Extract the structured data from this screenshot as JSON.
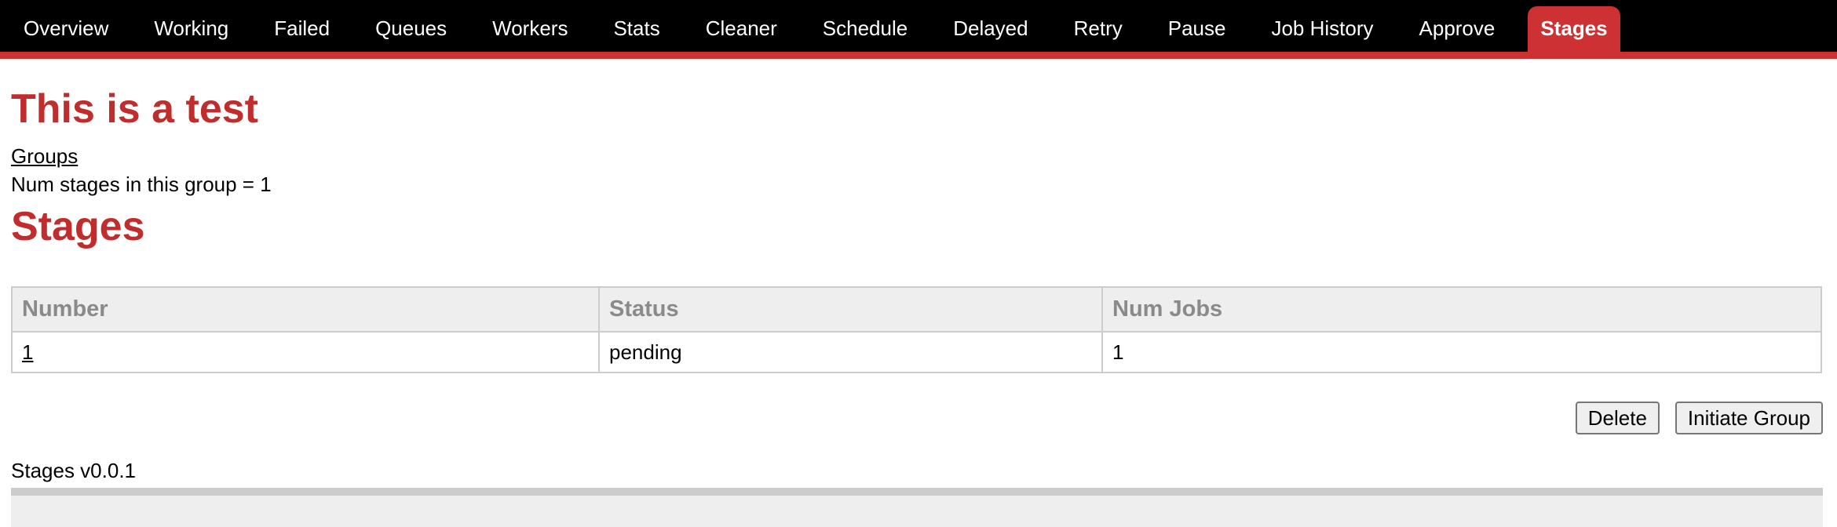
{
  "nav": {
    "tabs": [
      {
        "label": "Overview",
        "active": false
      },
      {
        "label": "Working",
        "active": false
      },
      {
        "label": "Failed",
        "active": false
      },
      {
        "label": "Queues",
        "active": false
      },
      {
        "label": "Workers",
        "active": false
      },
      {
        "label": "Stats",
        "active": false
      },
      {
        "label": "Cleaner",
        "active": false
      },
      {
        "label": "Schedule",
        "active": false
      },
      {
        "label": "Delayed",
        "active": false
      },
      {
        "label": "Retry",
        "active": false
      },
      {
        "label": "Pause",
        "active": false
      },
      {
        "label": "Job History",
        "active": false
      },
      {
        "label": "Approve",
        "active": false
      },
      {
        "label": "Stages",
        "active": true
      }
    ]
  },
  "page": {
    "title": "This is a test",
    "groups_link": "Groups",
    "num_stages_text": "Num stages in this group = 1",
    "section_title": "Stages"
  },
  "table": {
    "columns": [
      "Number",
      "Status",
      "Num Jobs"
    ],
    "rows": [
      {
        "number": "1",
        "status": "pending",
        "num_jobs": "1"
      }
    ]
  },
  "actions": {
    "delete_label": "Delete",
    "initiate_label": "Initiate Group"
  },
  "footer": {
    "version_text": "Stages v0.0.1"
  },
  "colors": {
    "accent": "#ce3133",
    "heading": "#c12d2d",
    "nav_bg": "#000000"
  }
}
